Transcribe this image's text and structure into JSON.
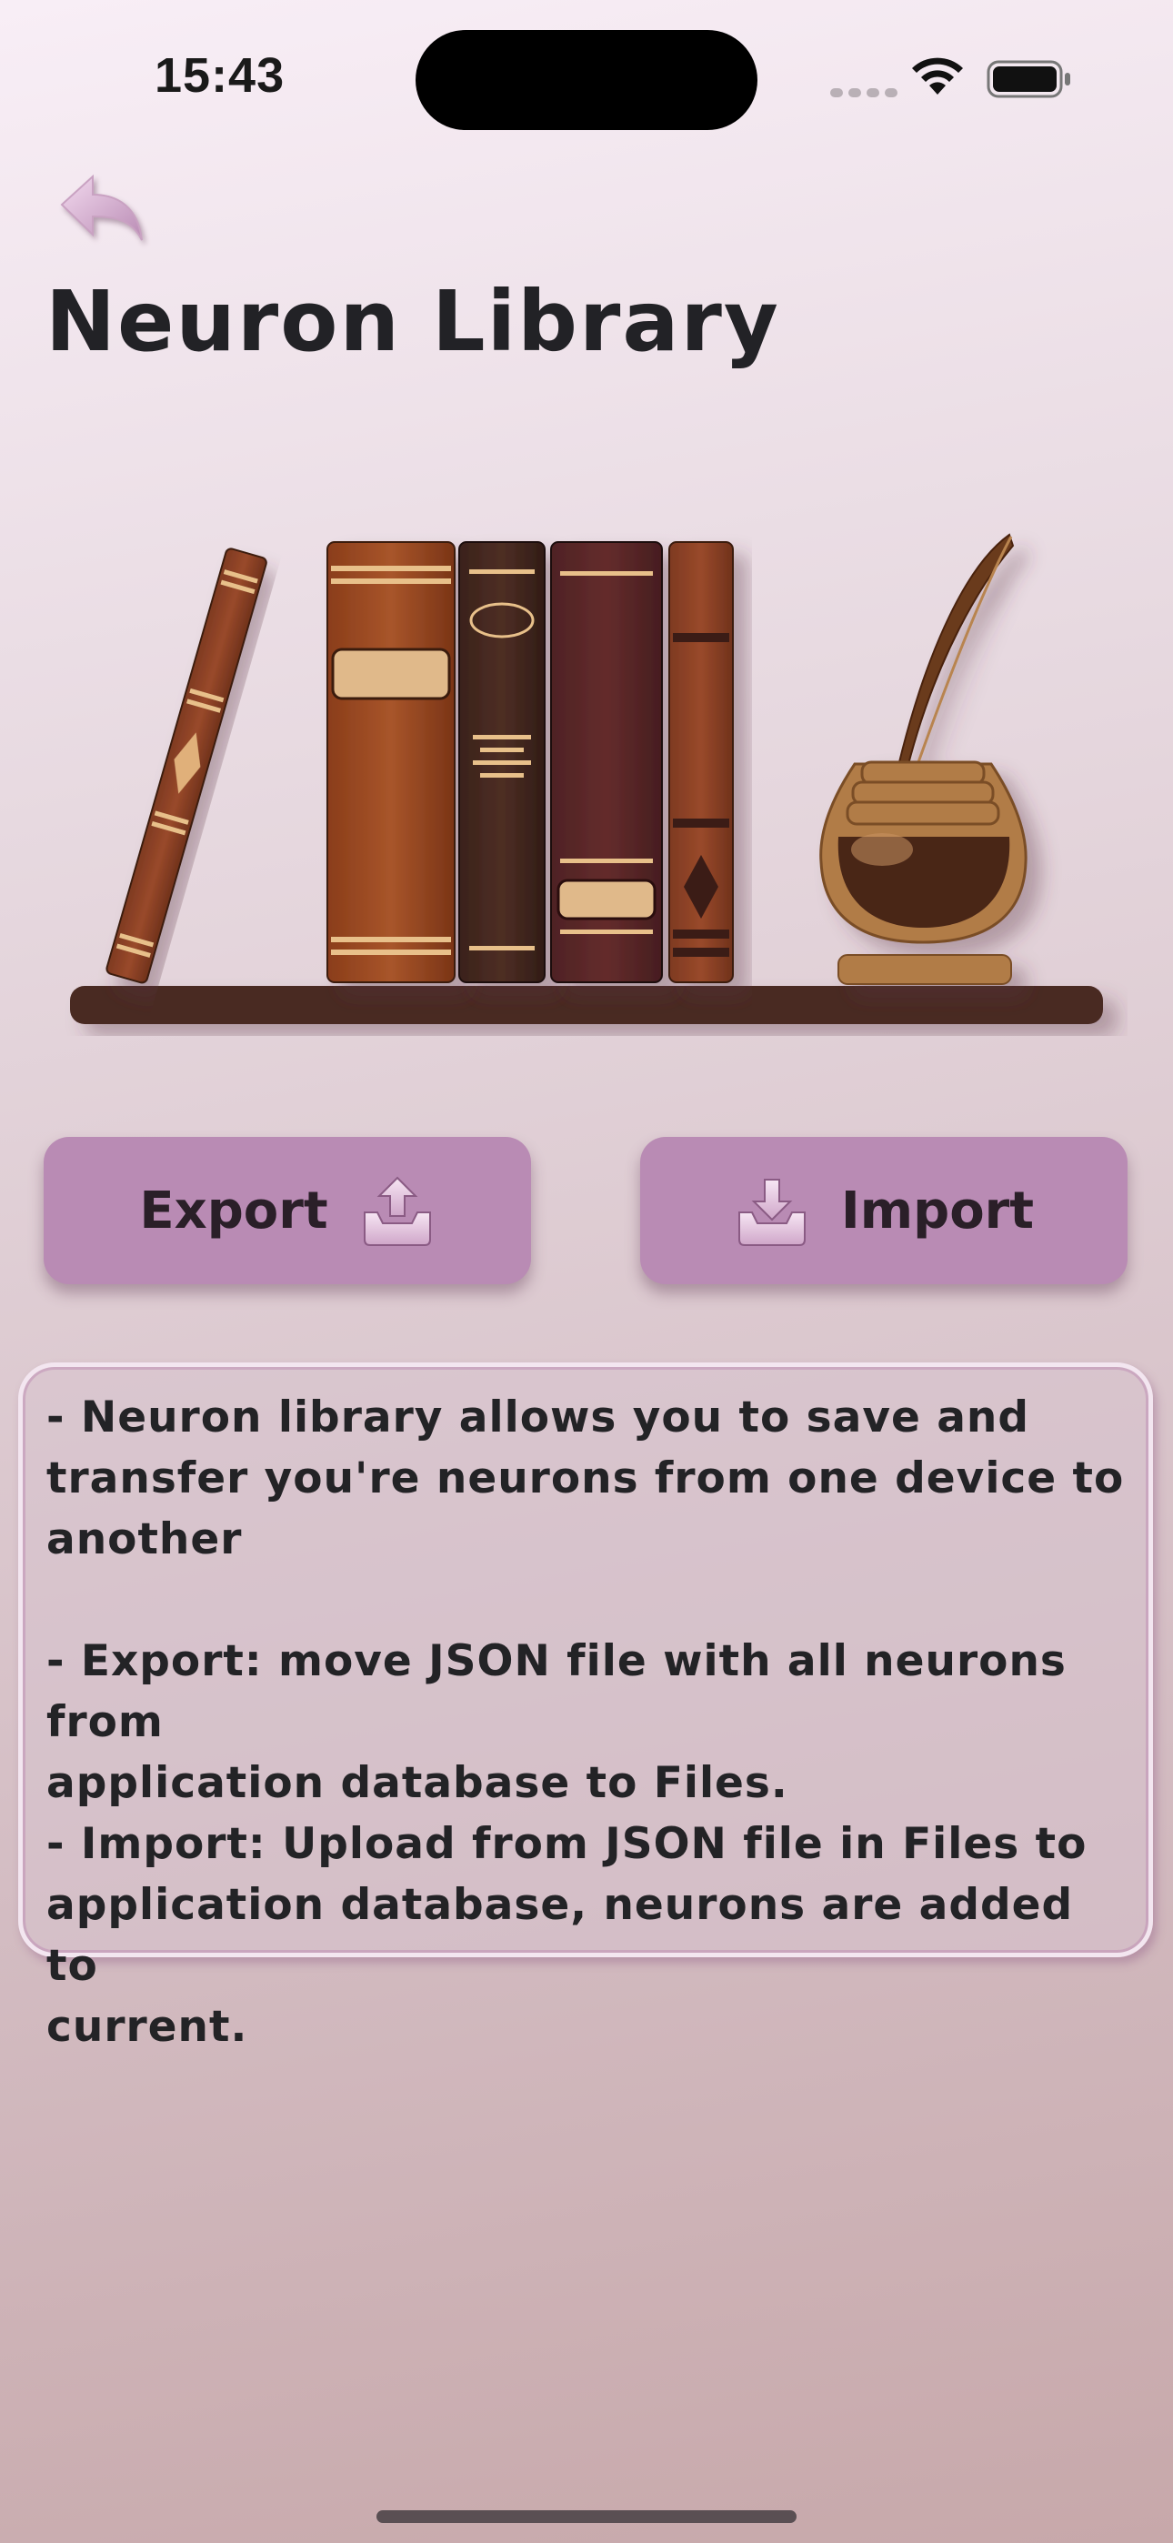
{
  "status_bar": {
    "time": "15:43",
    "icons": [
      "signal-icon",
      "wifi-icon",
      "battery-icon"
    ]
  },
  "header": {
    "back_icon": "back-arrow-icon",
    "title": "Neuron Library"
  },
  "illustration": {
    "name": "bookshelf-with-books-and-inkwell-quill"
  },
  "actions": {
    "export": {
      "label": "Export",
      "icon": "tray-upload-icon"
    },
    "import": {
      "label": "Import",
      "icon": "tray-download-icon"
    }
  },
  "info": {
    "text": "- Neuron library allows you to save and\ntransfer you're neurons from one device to\nanother\n\n- Export: move JSON file with all neurons from\napplication database to Files.\n- Import: Upload from JSON file in Files to\napplication database, neurons are added to\ncurrent."
  },
  "colors": {
    "button_bg": "#b98bb4",
    "shelf": "#4a2a22",
    "background_top": "#f8eef6",
    "background_bottom": "#c7a8aa"
  }
}
